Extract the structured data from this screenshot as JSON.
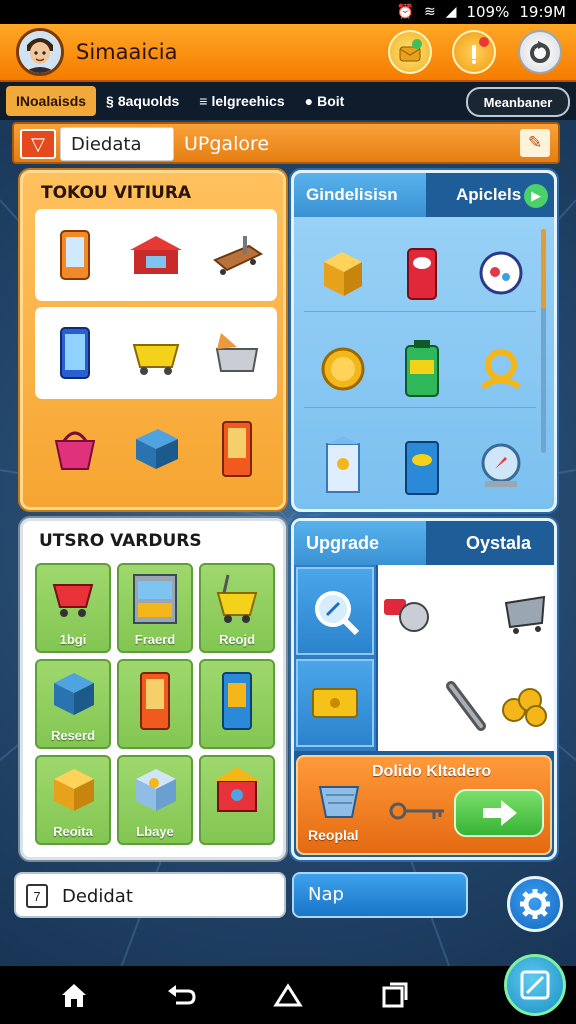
{
  "status_bar": {
    "battery": "109%",
    "time": "19:9M",
    "icons": [
      "alarm-icon",
      "wifi-icon",
      "signal-icon"
    ]
  },
  "header": {
    "title": "Simaaicia",
    "buttons": [
      "gift-notification-icon",
      "info-alert-icon",
      "refresh-icon"
    ]
  },
  "tabs": [
    {
      "label": "INoalaisds",
      "icon": ""
    },
    {
      "label": "8aquolds",
      "icon": "§"
    },
    {
      "label": "lelgreehics",
      "icon": "≡"
    },
    {
      "label": "Boit",
      "icon": "●"
    }
  ],
  "tab_pill": "Meanbaner",
  "search": {
    "value": "Diedata",
    "label": "UPgalore"
  },
  "panel_shop": {
    "title": "TOKOU VITIURA"
  },
  "panel_items": {
    "tab_left": "Gindelisisn",
    "tab_right": "Apiclels"
  },
  "panel_stores": {
    "title": "UTSRO VARDURS",
    "tiles": [
      "1bgi",
      "Fraerd",
      "Reojd",
      "Reserd",
      "",
      "",
      "Reoita",
      "Lbaye",
      ""
    ]
  },
  "panel_upgrade": {
    "tab_left": "Upgrade",
    "tab_right": "Oystala",
    "bottom_title": "Dolido Kltadero",
    "bottom_label": "Reoplal"
  },
  "bottom": {
    "input_label": "Dedidat",
    "map_label": "Nap"
  },
  "colors": {
    "header_orange": "#f57c00",
    "accent_blue": "#1a75c6",
    "tile_green": "#83c653"
  }
}
